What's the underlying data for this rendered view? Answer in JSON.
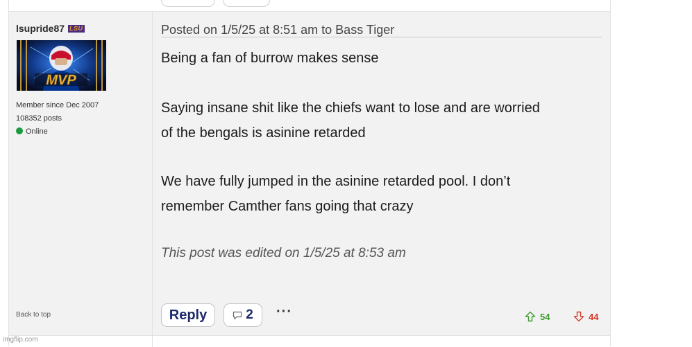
{
  "post": {
    "author": {
      "username": "lsupride87",
      "badge": "LSU",
      "avatar_text": "MVP",
      "member_since": "Member since Dec 2007",
      "post_count": "108352 posts",
      "status": "Online",
      "status_color": "#1a9b3c"
    },
    "header": "Posted on 1/5/25 at 8:51 am to Bass Tiger",
    "body": {
      "p1": "Being a fan of burrow makes sense",
      "p2_line1": "Saying insane shit like the chiefs want to lose and are worried",
      "p2_line2": "of the bengals is asinine retarded",
      "p3_line1": "We have fully jumped in the asinine retarded pool. I don’t",
      "p3_line2": "remember Camther fans going that crazy"
    },
    "edited_note": "This post was edited on 1/5/25 at 8:53 am",
    "actions": {
      "reply_label": "Reply",
      "comment_count": "2",
      "more_label": "···"
    },
    "votes": {
      "up": "54",
      "down": "44",
      "up_color": "#3a9a2a",
      "down_color": "#d63a2a"
    },
    "back_to_top": "Back to top"
  },
  "watermark": "imgflip.com"
}
